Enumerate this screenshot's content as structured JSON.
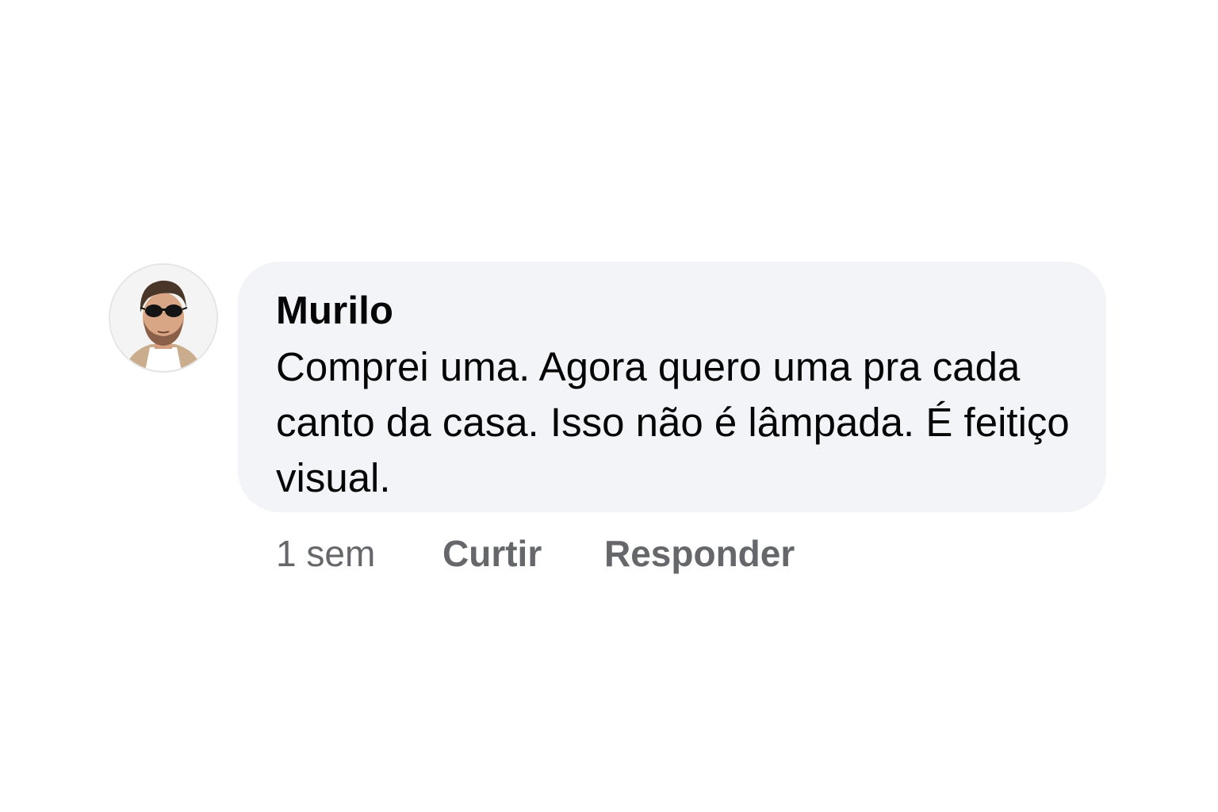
{
  "comment": {
    "author": "Murilo",
    "avatar_icon": "user-avatar-photo",
    "text": "Comprei uma. Agora quero uma pra cada canto da casa. Isso não é lâmpada. É feitiço visual.",
    "bubble_color": "#f3f4f8"
  },
  "actions": {
    "timestamp": "1 sem",
    "like_label": "Curtir",
    "reply_label": "Responder",
    "color": "#65676b"
  }
}
